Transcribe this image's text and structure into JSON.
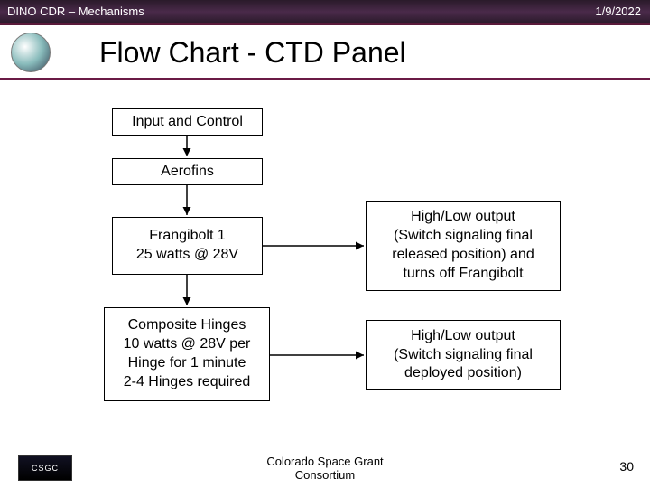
{
  "header": {
    "left": "DINO CDR – Mechanisms",
    "right": "1/9/2022"
  },
  "title": "Flow Chart - CTD Panel",
  "boxes": {
    "input": "Input and Control",
    "aerofins": "Aerofins",
    "frangibolt": "Frangibolt 1\n25 watts @ 28V",
    "hinges": "Composite Hinges\n10 watts @ 28V per\nHinge for 1 minute\n2-4 Hinges required",
    "highlow1": "High/Low output\n(Switch signaling final\nreleased position) and\nturns off Frangibolt",
    "highlow2": "High/Low output\n(Switch signaling final\ndeployed position)"
  },
  "footer": {
    "logo": "CSGC",
    "org": "Colorado Space Grant\nConsortium",
    "page": "30"
  }
}
